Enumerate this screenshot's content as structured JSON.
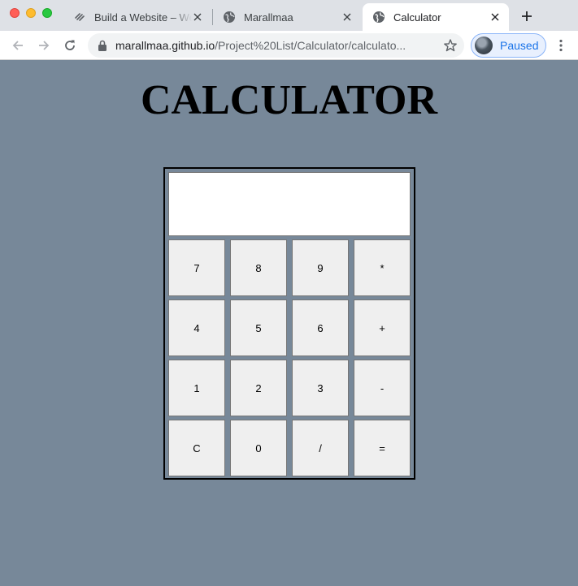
{
  "browser": {
    "tabs": [
      {
        "title": "Build a Website – We",
        "favicon": "squarespace-icon"
      },
      {
        "title": "Marallmaa",
        "favicon": "globe-icon"
      },
      {
        "title": "Calculator",
        "favicon": "globe-icon",
        "active": true
      }
    ],
    "url_host": "marallmaa.github.io",
    "url_path": "/Project%20List/Calculator/calculato...",
    "profile_label": "Paused",
    "accent_color": "#1a73e8"
  },
  "page": {
    "title": "CALCULATOR",
    "background": "#778899"
  },
  "calculator": {
    "display_value": "",
    "keys": [
      [
        "7",
        "8",
        "9",
        "*"
      ],
      [
        "4",
        "5",
        "6",
        "+"
      ],
      [
        "1",
        "2",
        "3",
        "-"
      ],
      [
        "C",
        "0",
        "/",
        "="
      ]
    ]
  }
}
